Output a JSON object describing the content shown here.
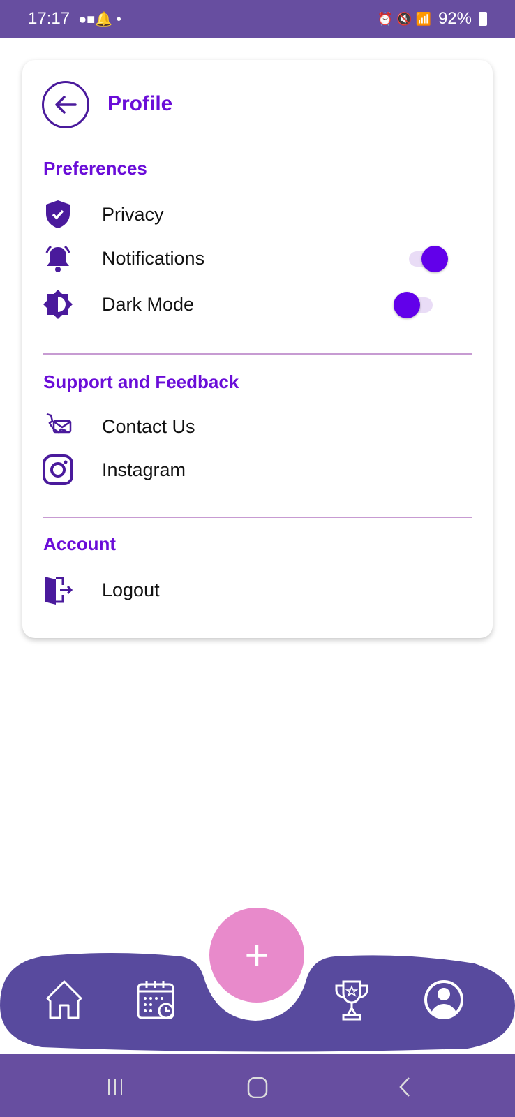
{
  "status_bar": {
    "time": "17:17",
    "battery": "92%"
  },
  "header": {
    "title": "Profile"
  },
  "sections": {
    "preferences": {
      "title": "Preferences",
      "items": [
        {
          "label": "Privacy",
          "icon": "shield-check-icon"
        },
        {
          "label": "Notifications",
          "icon": "bell-icon",
          "toggle": true
        },
        {
          "label": "Dark Mode",
          "icon": "contrast-icon",
          "toggle": false
        }
      ]
    },
    "support": {
      "title": "Support and Feedback",
      "items": [
        {
          "label": "Contact Us",
          "icon": "phone-mail-icon"
        },
        {
          "label": "Instagram",
          "icon": "instagram-icon"
        }
      ]
    },
    "account": {
      "title": "Account",
      "items": [
        {
          "label": "Logout",
          "icon": "logout-icon"
        }
      ]
    }
  },
  "bottom_nav": {
    "items": [
      "home-icon",
      "calendar-clock-icon",
      "add-icon",
      "trophy-icon",
      "profile-icon"
    ]
  },
  "colors": {
    "accent": "#6a0dd8",
    "toggle": "#6200ea",
    "nav": "#584a9e",
    "fab": "#e88acb",
    "status_bar": "#674ea0"
  }
}
